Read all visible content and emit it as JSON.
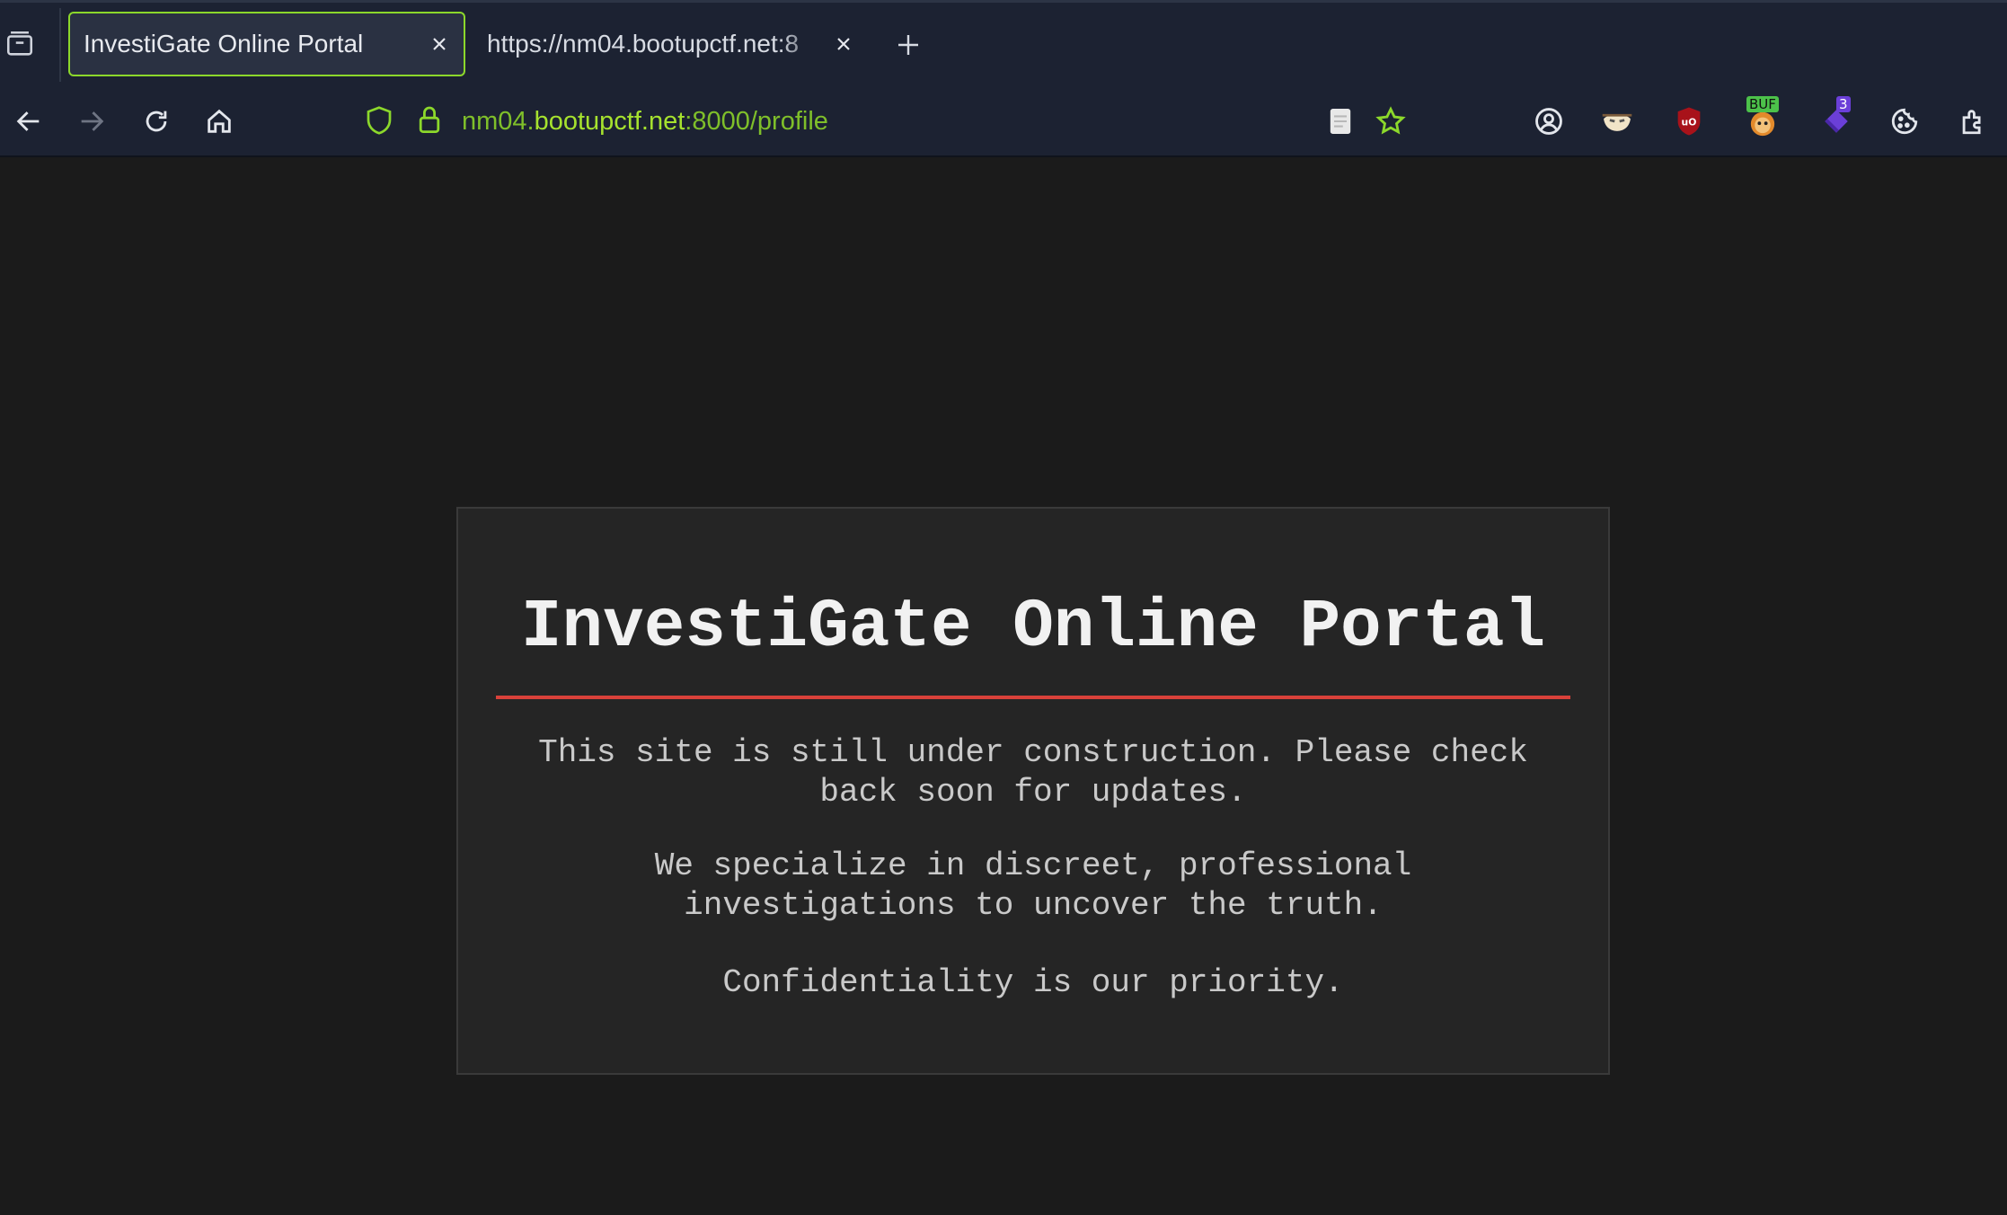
{
  "browser": {
    "tabs": [
      {
        "title": "InvestiGate Online Portal",
        "active": true
      },
      {
        "title": "https://nm04.bootupctf.net:8",
        "active": false
      }
    ],
    "url": {
      "subdomain": "nm04.",
      "host": "bootupctf.net",
      "rest": ":8000/profile"
    },
    "extensions": [
      {
        "name": "bug-bounty-extension",
        "badge": "BUF"
      },
      {
        "name": "counter-extension",
        "badge": "3"
      }
    ],
    "accent_color": "#8cd82b"
  },
  "page": {
    "title": "InvestiGate Online Portal",
    "paragraphs": [
      "This site is still under construction. Please check back soon for updates.",
      "We specialize in discreet, professional investigations to uncover the truth.",
      "Confidentiality is our priority."
    ],
    "rule_color": "#d9413a"
  }
}
